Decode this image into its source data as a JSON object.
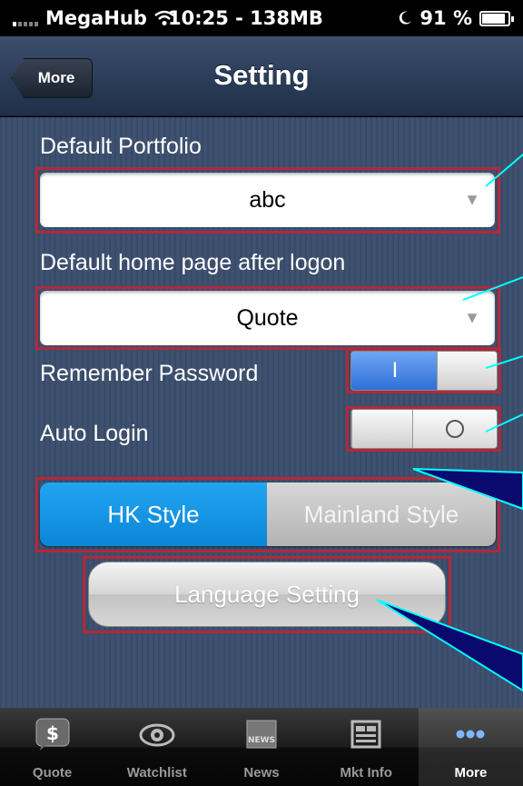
{
  "status_bar": {
    "carrier": "MegaHub",
    "time": "10:25 - 138MB",
    "battery": "91 %",
    "battery_level": 0.91
  },
  "nav": {
    "title": "Setting",
    "back_label": "More"
  },
  "settings": {
    "portfolio_label": "Default Portfolio",
    "portfolio_value": "abc",
    "homepage_label": "Default home page after logon",
    "homepage_value": "Quote",
    "remember_label": "Remember Password",
    "remember_on_glyph": "I",
    "remember_on": true,
    "autologin_label": "Auto Login",
    "autologin_on": false,
    "style_hk": "HK Style",
    "style_mainland": "Mainland Style",
    "style_selected": "HK Style",
    "language_button": "Language Setting"
  },
  "tabs": [
    {
      "label": "Quote",
      "icon": "quote-icon"
    },
    {
      "label": "Watchlist",
      "icon": "eye-icon"
    },
    {
      "label": "News",
      "icon": "news-icon",
      "icon_text": "NEWS"
    },
    {
      "label": "Mkt Info",
      "icon": "mkt-info-icon"
    },
    {
      "label": "More",
      "icon": "more-dots-icon"
    }
  ],
  "colors": {
    "accent_blue": "#0b86d6",
    "highlight_red": "#b3283a",
    "callout_cyan": "#00ffff",
    "callout_navy": "#0a0a6e"
  }
}
